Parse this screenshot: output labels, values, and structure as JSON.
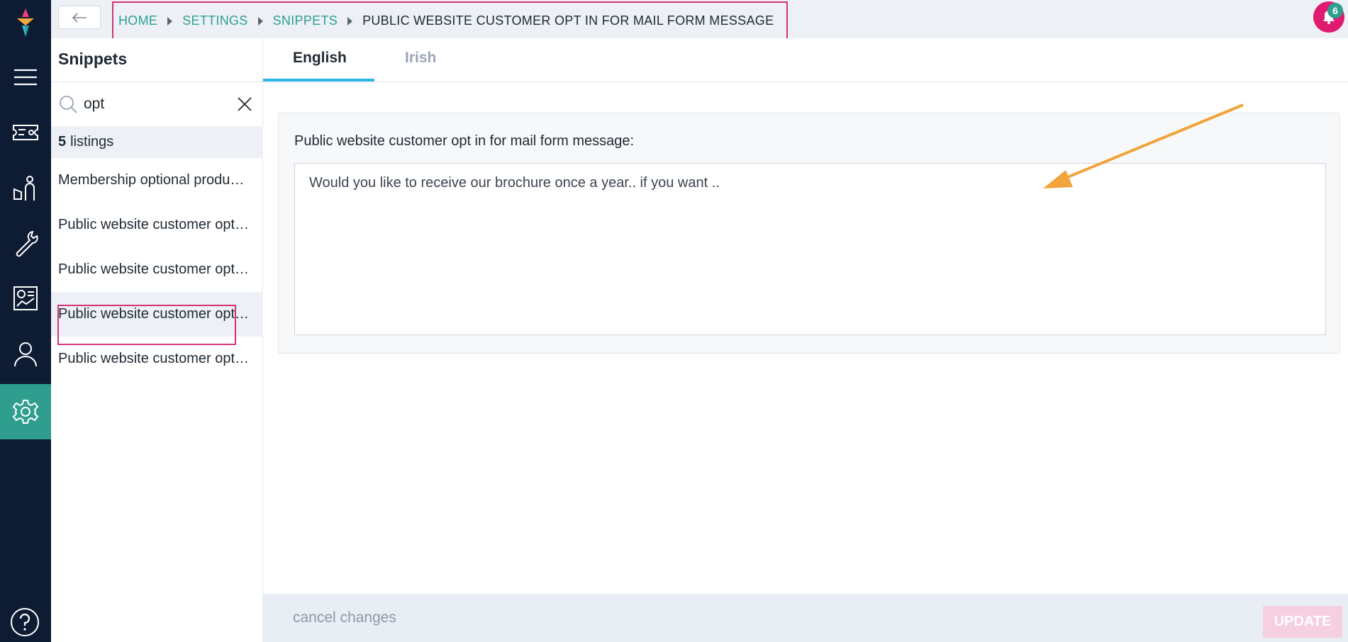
{
  "nav": {
    "items": [
      {
        "name": "menu-icon"
      },
      {
        "name": "tickets-icon"
      },
      {
        "name": "customer-icon"
      },
      {
        "name": "tools-icon"
      },
      {
        "name": "reports-icon"
      },
      {
        "name": "user-icon"
      },
      {
        "name": "settings-icon",
        "active": true
      }
    ],
    "help_icon": "help-icon"
  },
  "header": {
    "back_icon": "arrow-left-icon",
    "breadcrumb": {
      "home": "HOME",
      "settings": "SETTINGS",
      "snippets": "SNIPPETS",
      "current": "PUBLIC WEBSITE CUSTOMER OPT IN FOR MAIL FORM MESSAGE"
    },
    "notifications": {
      "icon": "bell-icon",
      "count": "6"
    }
  },
  "list_panel": {
    "title": "Snippets",
    "search": {
      "value": "opt",
      "icon": "search-icon",
      "clear_icon": "close-icon"
    },
    "count_number": "5",
    "count_label": "listings",
    "items": [
      {
        "label": "Membership optional product description"
      },
      {
        "label": "Public website customer opt in for email form message"
      },
      {
        "label": "Public website customer opt in for sms form message"
      },
      {
        "label": "Public website customer opt in for mail form message",
        "selected": true
      },
      {
        "label": "Public website customer opt in for phone form message"
      }
    ]
  },
  "main": {
    "tabs": [
      {
        "label": "English",
        "active": true
      },
      {
        "label": "Irish",
        "active": false
      }
    ],
    "field_label": "Public website customer opt in for mail form message:",
    "field_value": "Would you like to receive our brochure once a year.. if you want .."
  },
  "footer": {
    "cancel_label": "cancel changes",
    "update_label": "UPDATE"
  },
  "colors": {
    "rail": "#0d1b33",
    "accent": "#2f9e8f",
    "highlight": "#d6317a",
    "annotation_arrow": "#f2a33a",
    "tab_underline": "#2eb4e6"
  }
}
